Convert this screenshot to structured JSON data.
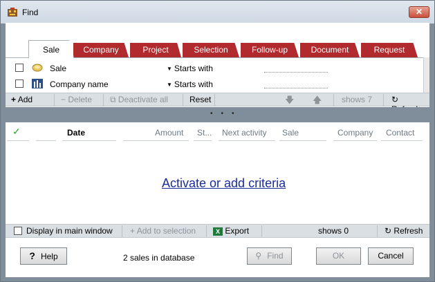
{
  "window": {
    "title": "Find",
    "close_label": "✕"
  },
  "tabs": [
    "Sale",
    "Company",
    "Project",
    "Selection",
    "Follow-up",
    "Document",
    "Request"
  ],
  "criteria": [
    {
      "label": "Sale",
      "operator": "Starts with",
      "icon": "sale-icon"
    },
    {
      "label": "Company name",
      "operator": "Starts with",
      "icon": "company-icon"
    }
  ],
  "criteria_toolbar": {
    "add": "Add",
    "delete": "Delete",
    "deactivate_all": "Deactivate all",
    "reset": "Reset",
    "shows": "shows 7",
    "refresh": "Refresh"
  },
  "grid": {
    "columns": [
      "Date",
      "Amount",
      "St...",
      "Next activity",
      "Sale",
      "Company",
      "Contact"
    ],
    "empty_link": "Activate or add criteria"
  },
  "results_toolbar": {
    "display_main": "Display in main window",
    "add_to_selection": "Add to selection",
    "export": "Export",
    "shows": "shows 0",
    "refresh": "Refresh"
  },
  "footer": {
    "help": "Help",
    "db_info": "2 sales in database",
    "find": "Find",
    "ok": "OK",
    "cancel": "Cancel"
  },
  "colors": {
    "tab_red": "#b02a2e",
    "frame": "#7f8e9a",
    "link": "#1a2c9a"
  }
}
